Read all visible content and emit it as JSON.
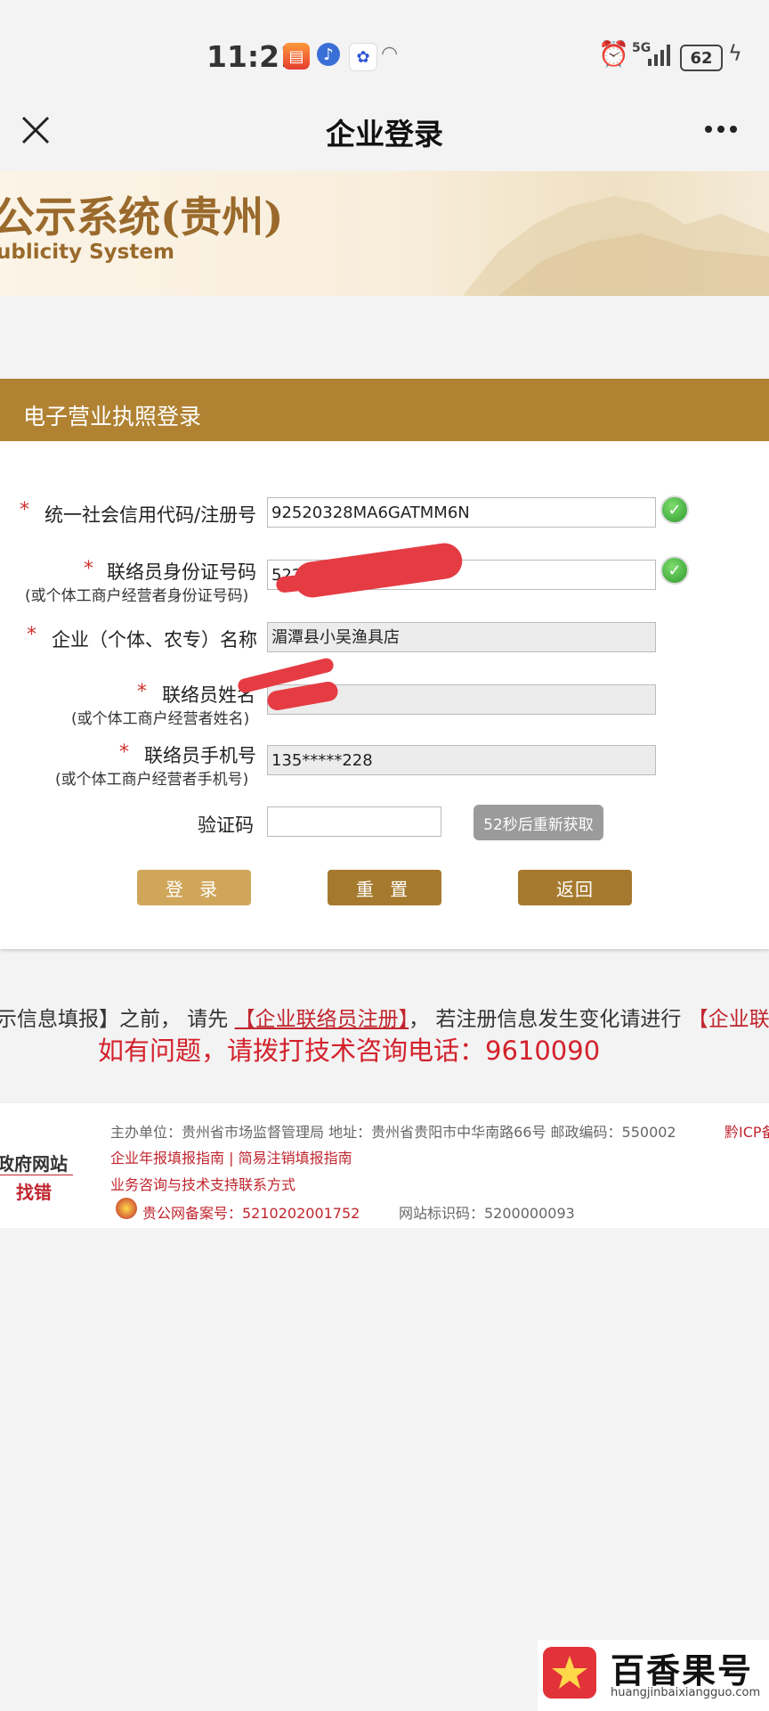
{
  "status_bar": {
    "time": "11:21",
    "network": "5G",
    "battery": "62",
    "icons": [
      "app-orange-icon",
      "music-icon",
      "baidu-paw-icon",
      "wifi-icon",
      "alarm-icon",
      "signal-icon",
      "charging-icon"
    ]
  },
  "nav": {
    "title": "企业登录",
    "close_icon": "close-icon",
    "more_icon": "more-icon"
  },
  "banner": {
    "title": "公示系统(贵州)",
    "subtitle": "ublicity System"
  },
  "panel": {
    "title": "电子营业执照登录",
    "fields": {
      "credit_code": {
        "label": "统一社会信用代码/注册号",
        "value": "92520328MA6GATMM6N"
      },
      "id_number": {
        "label": "联络员身份证号码",
        "sublabel": "(或个体工商户经营者身份证号码)",
        "value": "5227"
      },
      "company_name": {
        "label": "企业（个体、农专）名称",
        "value": "湄潭县小吴渔具店"
      },
      "contact_name": {
        "label": "联络员姓名",
        "sublabel": "(或个体工商户经营者姓名)",
        "value": "吴"
      },
      "phone": {
        "label": "联络员手机号",
        "sublabel": "(或个体工商户经营者手机号)",
        "value": "135*****228"
      },
      "captcha": {
        "label": "验证码",
        "value": "",
        "button": "52秒后重新获取"
      }
    },
    "buttons": {
      "login": "登 录",
      "reset": "重 置",
      "back": "返回"
    }
  },
  "notices": {
    "line1_prefix": "示信息填报】之前， 请先 ",
    "line1_link1": "【企业联络员注册】",
    "line1_middle": "， 若注册信息发生变化请进行 ",
    "line1_link2": "【企业联",
    "line2": "如有问题，请拨打技术咨询电话：9610090"
  },
  "footer": {
    "sponsor_line": "主办单位：贵州省市场监督管理局 地址：贵州省贵阳市中华南路66号 邮政编码：550002",
    "icp": "黔ICP备",
    "guide_links": "企业年报填报指南 | 简易注销填报指南",
    "support": "业务咨询与技术支持联系方式",
    "police_record": "贵公网备案号：5210202001752",
    "site_id": "网站标识码：5200000093",
    "gov_badge_1": "政府网站",
    "gov_badge_2": "找错"
  },
  "watermark": {
    "text": "百香果号",
    "url": "huangjinbaixiangguo.com"
  },
  "colors": {
    "accent_gold": "#b08232",
    "required_star": "#d0312d",
    "notice_red": "#d3222c",
    "check_green": "#3aa83a"
  }
}
